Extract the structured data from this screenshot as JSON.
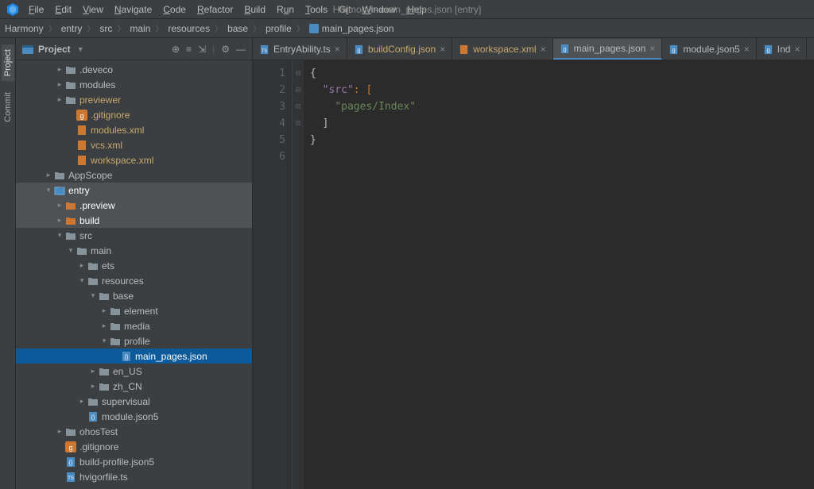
{
  "window_title": "Harmony - main_pages.json [entry]",
  "menu": [
    "File",
    "Edit",
    "View",
    "Navigate",
    "Code",
    "Refactor",
    "Build",
    "Run",
    "Tools",
    "Git",
    "Window",
    "Help"
  ],
  "breadcrumbs": [
    "Harmony",
    "entry",
    "src",
    "main",
    "resources",
    "base",
    "profile",
    "main_pages.json"
  ],
  "project_panel": {
    "title": "Project",
    "tools": [
      "target",
      "select",
      "expand",
      "gear",
      "hide"
    ]
  },
  "tree": [
    {
      "d": 3,
      "a": ">",
      "i": "folder",
      "t": ".deveco",
      "c": "",
      "sel": ""
    },
    {
      "d": 3,
      "a": ">",
      "i": "folder",
      "t": "modules",
      "c": "",
      "sel": ""
    },
    {
      "d": 3,
      "a": ">",
      "i": "folder",
      "t": "previewer",
      "c": "yellow",
      "sel": ""
    },
    {
      "d": 4,
      "a": "",
      "i": "git",
      "t": ".gitignore",
      "c": "yellow",
      "sel": ""
    },
    {
      "d": 4,
      "a": "",
      "i": "orangefile",
      "t": "modules.xml",
      "c": "yellow",
      "sel": ""
    },
    {
      "d": 4,
      "a": "",
      "i": "orangefile",
      "t": "vcs.xml",
      "c": "yellow",
      "sel": ""
    },
    {
      "d": 4,
      "a": "",
      "i": "orangefile",
      "t": "workspace.xml",
      "c": "yellow",
      "sel": ""
    },
    {
      "d": 2,
      "a": ">",
      "i": "folder",
      "t": "AppScope",
      "c": "",
      "sel": ""
    },
    {
      "d": 2,
      "a": "v",
      "i": "module",
      "t": "entry",
      "c": "blue",
      "sel": "ctx"
    },
    {
      "d": 3,
      "a": ">",
      "i": "folder-o",
      "t": ".preview",
      "c": "orange",
      "sel": "ctx"
    },
    {
      "d": 3,
      "a": ">",
      "i": "folder-o",
      "t": "build",
      "c": "orange",
      "sel": "ctx"
    },
    {
      "d": 3,
      "a": "v",
      "i": "folder",
      "t": "src",
      "c": "",
      "sel": ""
    },
    {
      "d": 4,
      "a": "v",
      "i": "folder",
      "t": "main",
      "c": "",
      "sel": ""
    },
    {
      "d": 5,
      "a": ">",
      "i": "folder",
      "t": "ets",
      "c": "",
      "sel": ""
    },
    {
      "d": 5,
      "a": "v",
      "i": "folder",
      "t": "resources",
      "c": "",
      "sel": ""
    },
    {
      "d": 6,
      "a": "v",
      "i": "folder",
      "t": "base",
      "c": "",
      "sel": ""
    },
    {
      "d": 7,
      "a": ">",
      "i": "folder",
      "t": "element",
      "c": "",
      "sel": ""
    },
    {
      "d": 7,
      "a": ">",
      "i": "folder",
      "t": "media",
      "c": "",
      "sel": ""
    },
    {
      "d": 7,
      "a": "v",
      "i": "folder",
      "t": "profile",
      "c": "",
      "sel": ""
    },
    {
      "d": 8,
      "a": "",
      "i": "json",
      "t": "main_pages.json",
      "c": "",
      "sel": "sel"
    },
    {
      "d": 6,
      "a": ">",
      "i": "folder",
      "t": "en_US",
      "c": "",
      "sel": ""
    },
    {
      "d": 6,
      "a": ">",
      "i": "folder",
      "t": "zh_CN",
      "c": "",
      "sel": ""
    },
    {
      "d": 5,
      "a": ">",
      "i": "folder",
      "t": "supervisual",
      "c": "",
      "sel": ""
    },
    {
      "d": 5,
      "a": "",
      "i": "json",
      "t": "module.json5",
      "c": "",
      "sel": ""
    },
    {
      "d": 3,
      "a": ">",
      "i": "folder",
      "t": "ohosTest",
      "c": "",
      "sel": ""
    },
    {
      "d": 3,
      "a": "",
      "i": "git",
      "t": ".gitignore",
      "c": "",
      "sel": ""
    },
    {
      "d": 3,
      "a": "",
      "i": "json",
      "t": "build-profile.json5",
      "c": "",
      "sel": ""
    },
    {
      "d": 3,
      "a": "",
      "i": "ts",
      "t": "hvigorfile.ts",
      "c": "",
      "sel": ""
    }
  ],
  "tabs": [
    {
      "icon": "ts",
      "name": "EntryAbility.ts",
      "cl": "",
      "active": false
    },
    {
      "icon": "json",
      "name": "buildConfig.json",
      "cl": "yellow",
      "active": false
    },
    {
      "icon": "orangefile",
      "name": "workspace.xml",
      "cl": "yellow",
      "active": false
    },
    {
      "icon": "json",
      "name": "main_pages.json",
      "cl": "",
      "active": true
    },
    {
      "icon": "json",
      "name": "module.json5",
      "cl": "",
      "active": false
    },
    {
      "icon": "json",
      "name": "Ind",
      "cl": "",
      "active": false
    }
  ],
  "gutter_tools": [
    "Project",
    "Commit"
  ],
  "code": {
    "lines": [
      "1",
      "2",
      "3",
      "4",
      "5",
      "6"
    ],
    "l1_a": "{",
    "l2_a": "\"src\"",
    "l2_b": ": [",
    "l3_a": "\"pages/Index\"",
    "l4_a": "]",
    "l5_a": "}"
  }
}
